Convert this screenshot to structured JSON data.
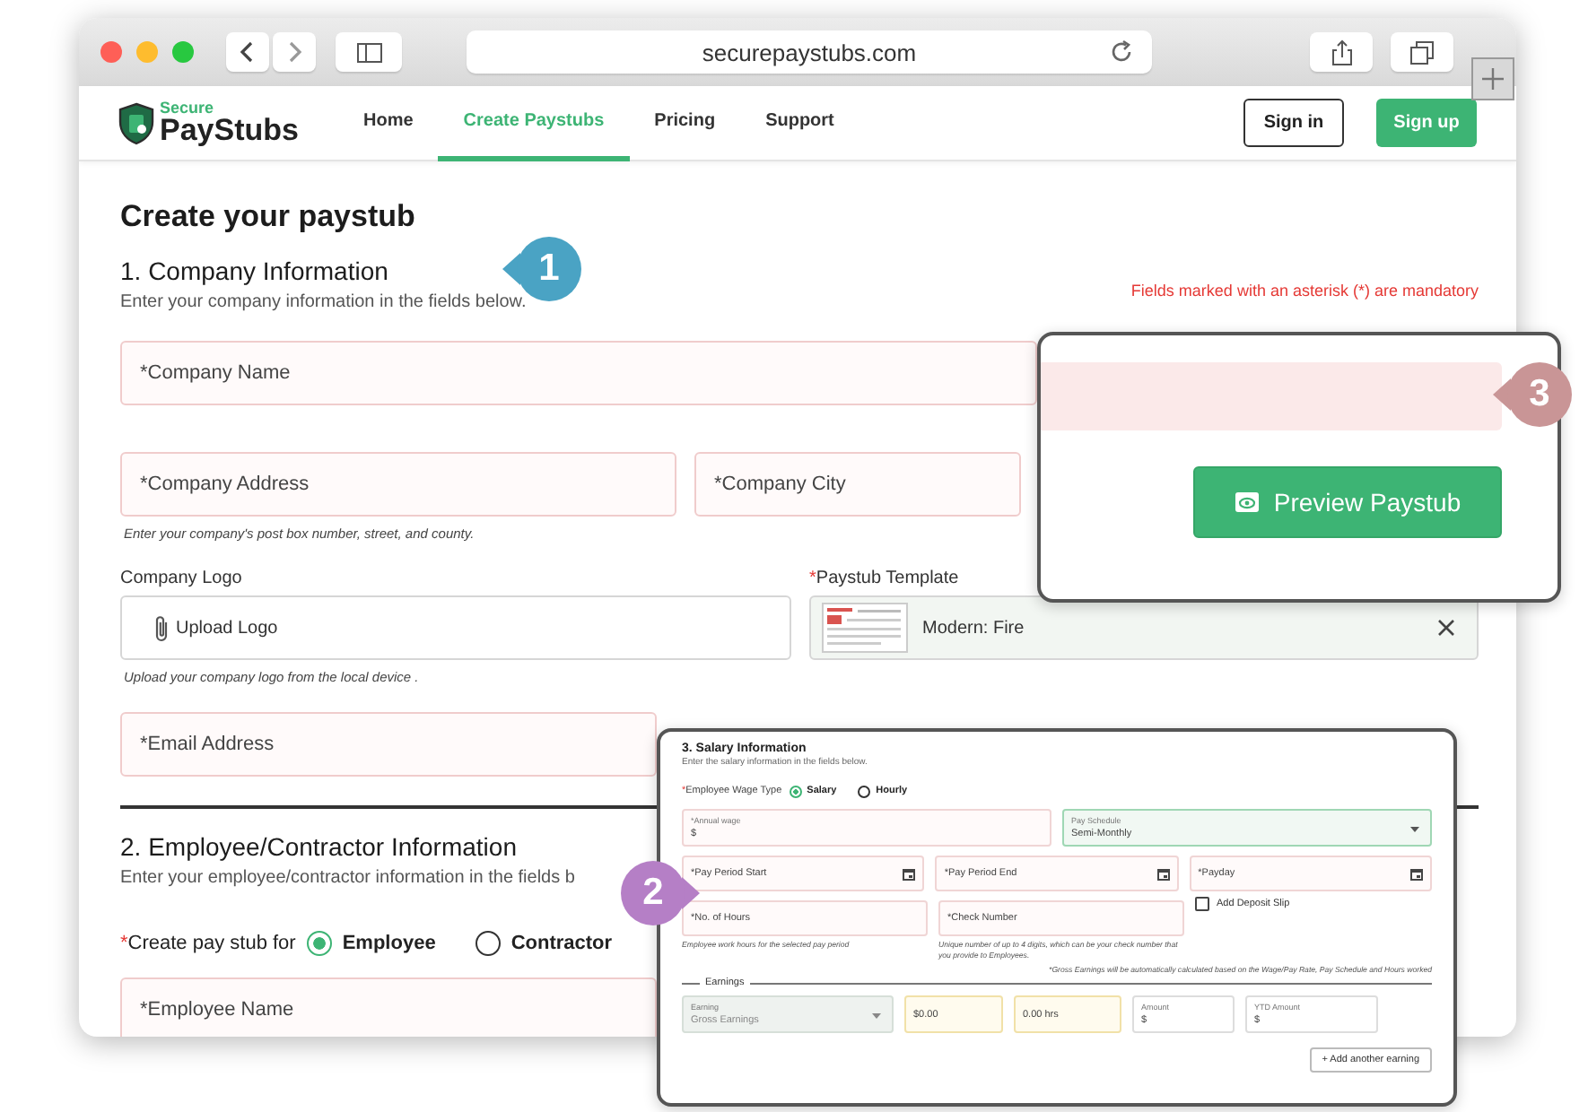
{
  "browser": {
    "url": "securepaystubs.com"
  },
  "nav": {
    "logo": {
      "top": "Secure",
      "bottom": "PayStubs"
    },
    "links": [
      {
        "label": "Home",
        "selected": false
      },
      {
        "label": "Create Paystubs",
        "selected": true
      },
      {
        "label": "Pricing",
        "selected": false
      },
      {
        "label": "Support",
        "selected": false
      }
    ],
    "buttons": [
      {
        "label": "Sign in",
        "kind": "outline"
      },
      {
        "label": "Sign up",
        "kind": "primary"
      }
    ]
  },
  "page": {
    "title": "Create your paystub",
    "mandatory_note": "Fields marked with an asterisk (*) are mandatory"
  },
  "company": {
    "heading": "1. Company Information",
    "description": "Enter your company information in the fields below.",
    "name_field": {
      "placeholder": "*Company Name"
    },
    "address_field": {
      "placeholder": "*Company Address"
    },
    "city_field": {
      "placeholder": "*Company City"
    },
    "address_hint": "Enter your company's post box number, street, and county.",
    "logo": {
      "label": "Company Logo",
      "button": "Upload Logo",
      "hint": "Upload your company logo from the local device ."
    },
    "template": {
      "mark": "*",
      "label": "Paystub Template",
      "value": "Modern: Fire"
    },
    "email_field": {
      "placeholder": "*Email Address"
    }
  },
  "employee": {
    "heading": "2. Employee/Contractor Information",
    "description": "Enter your employee/contractor information in the fields b",
    "stub_for": {
      "mark": "*",
      "label": "Create pay stub for",
      "options": [
        {
          "label": "Employee",
          "selected": true
        },
        {
          "label": "Contractor",
          "selected": false
        }
      ]
    },
    "name_field": {
      "placeholder": "*Employee Name"
    }
  },
  "preview_inset": {
    "button": "Preview Paystub"
  },
  "salary_inset": {
    "heading": "3. Salary Information",
    "description": "Enter the salary information in the fields below.",
    "wage_type": {
      "mark": "*",
      "label": "Employee Wage Type",
      "options": [
        {
          "label": "Salary",
          "selected": true
        },
        {
          "label": "Hourly",
          "selected": false
        }
      ]
    },
    "annual_wage": {
      "label": "*Annual wage",
      "value": "$"
    },
    "pay_schedule": {
      "label": "Pay Schedule",
      "value": "Semi-Monthly"
    },
    "date_fields": [
      {
        "placeholder": "*Pay Period Start"
      },
      {
        "placeholder": "*Pay Period End"
      },
      {
        "placeholder": "*Payday"
      }
    ],
    "hours_field": {
      "placeholder": "*No. of Hours",
      "hint": "Employee work hours for the selected pay period"
    },
    "check_field": {
      "placeholder": "*Check Number",
      "hint": "Unique number of up to 4 digits, which can be your check number that you provide to Employees."
    },
    "deposit_slip": {
      "label": "Add Deposit Slip",
      "checked": false
    },
    "gross_note": "*Gross Earnings will be automatically calculated based on the Wage/Pay Rate, Pay Schedule and Hours worked",
    "earnings": {
      "legend": "Earnings",
      "earning": {
        "label": "Earning",
        "value": "Gross Earnings"
      },
      "rate": {
        "value": "$0.00"
      },
      "hours": {
        "value": "0.00 hrs"
      },
      "amount": {
        "label": "Amount",
        "value": "$"
      },
      "ytd_amount": {
        "label": "YTD Amount",
        "value": "$"
      }
    },
    "add_button": "+ Add another earning"
  },
  "step_badges": [
    {
      "number": "1",
      "color": "#4aa3c4"
    },
    {
      "number": "2",
      "color": "#b57fc6"
    },
    {
      "number": "3",
      "color": "#c99596"
    }
  ]
}
